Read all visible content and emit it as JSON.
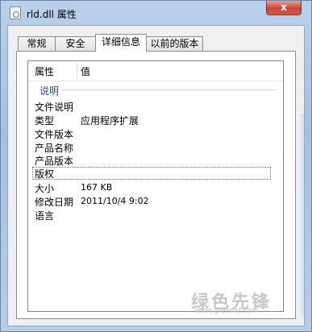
{
  "window": {
    "title": "rld.dll 属性",
    "close_glyph": "x"
  },
  "tabs": [
    {
      "label": "常规"
    },
    {
      "label": "安全"
    },
    {
      "label": "详细信息"
    },
    {
      "label": "以前的版本"
    }
  ],
  "list": {
    "headers": {
      "property": "属性",
      "value": "值"
    },
    "group": "说明",
    "rows": [
      {
        "key": "文件说明",
        "value": ""
      },
      {
        "key": "类型",
        "value": "应用程序扩展"
      },
      {
        "key": "文件版本",
        "value": ""
      },
      {
        "key": "产品名称",
        "value": ""
      },
      {
        "key": "产品版本",
        "value": ""
      },
      {
        "key": "版权",
        "value": ""
      },
      {
        "key": "大小",
        "value": "167 KB"
      },
      {
        "key": "修改日期",
        "value": "2011/10/4 9:02"
      },
      {
        "key": "语言",
        "value": ""
      }
    ]
  },
  "watermark": {
    "text": "绿色先锋",
    "url": "www.greenxf.com"
  }
}
